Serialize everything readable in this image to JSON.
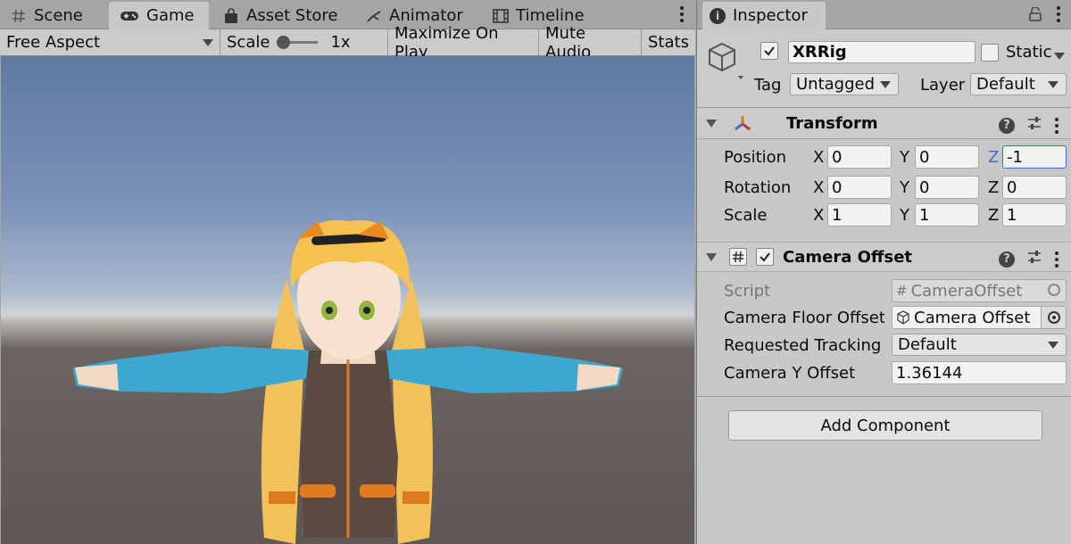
{
  "game_view": {
    "tabs": [
      {
        "label": "Scene",
        "icon": "hash-icon"
      },
      {
        "label": "Game",
        "icon": "gamepad-icon"
      },
      {
        "label": "Asset Store",
        "icon": "shopping-bag-icon"
      },
      {
        "label": "Animator",
        "icon": "animator-icon"
      },
      {
        "label": "Timeline",
        "icon": "film-icon"
      }
    ],
    "toolbar": {
      "aspect": "Free Aspect",
      "scale_label": "Scale",
      "scale_value": "1x",
      "maximize": "Maximize On Play",
      "mute": "Mute Audio",
      "stats": "Stats"
    }
  },
  "inspector": {
    "tab_label": "Inspector",
    "object": {
      "name": "XRRig",
      "static_label": "Static",
      "tag_label": "Tag",
      "tag_value": "Untagged",
      "layer_label": "Layer",
      "layer_value": "Default"
    },
    "transform": {
      "title": "Transform",
      "rows": [
        {
          "label": "Position",
          "x": "0",
          "y": "0",
          "z": "-1"
        },
        {
          "label": "Rotation",
          "x": "0",
          "y": "0",
          "z": "0"
        },
        {
          "label": "Scale",
          "x": "1",
          "y": "1",
          "z": "1"
        }
      ],
      "axis_x": "X",
      "axis_y": "Y",
      "axis_z": "Z"
    },
    "camera_offset": {
      "title": "Camera Offset",
      "script_label": "Script",
      "script_value": "CameraOffset",
      "floor_label": "Camera Floor Offset O",
      "floor_value": "Camera Offset",
      "tracking_label": "Requested Tracking M",
      "tracking_value": "Default",
      "y_offset_label": "Camera Y Offset",
      "y_offset_value": "1.36144"
    },
    "add_component": "Add Component"
  },
  "colors": {
    "panel_bg": "#c8c8c8",
    "tabbar_bg": "#a5a5a5",
    "focus_border": "#3a72c4",
    "sky_top": "#5f7aa3",
    "ground": "#5e5754"
  }
}
